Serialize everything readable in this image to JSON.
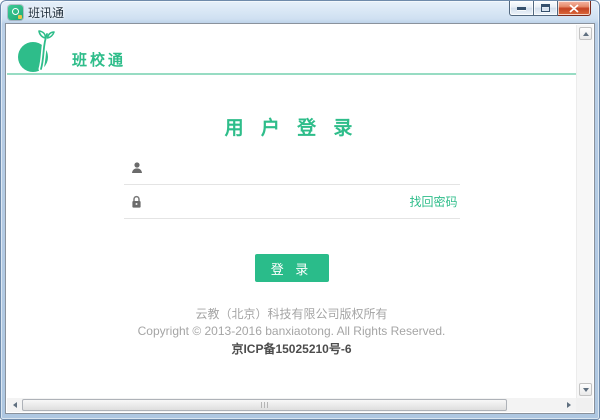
{
  "window": {
    "title": "班讯通"
  },
  "brand": {
    "name": "班校通"
  },
  "login": {
    "heading": "用 户 登 录",
    "username": {
      "value": "",
      "placeholder": ""
    },
    "password": {
      "value": "",
      "placeholder": ""
    },
    "forgot_password_label": "找回密码",
    "login_button_label": "登 录"
  },
  "footer": {
    "company": "云教（北京）科技有限公司版权所有",
    "copyright": "Copyright © 2013-2016 banxiaotong. All Rights Reserved.",
    "icp": "京ICP备15025210号-6"
  },
  "icons": {
    "app_icon": "sprout-app-icon",
    "logo": "sprout-logo",
    "username": "person-icon",
    "password": "lock-icon"
  },
  "colors": {
    "accent": "#2ebd8a",
    "divider": "#97dcc3",
    "button": "#2abc8a",
    "underline": "#e4e4e4",
    "footer_gray": "#a5a5a5",
    "icp": "#4c4c4c"
  }
}
